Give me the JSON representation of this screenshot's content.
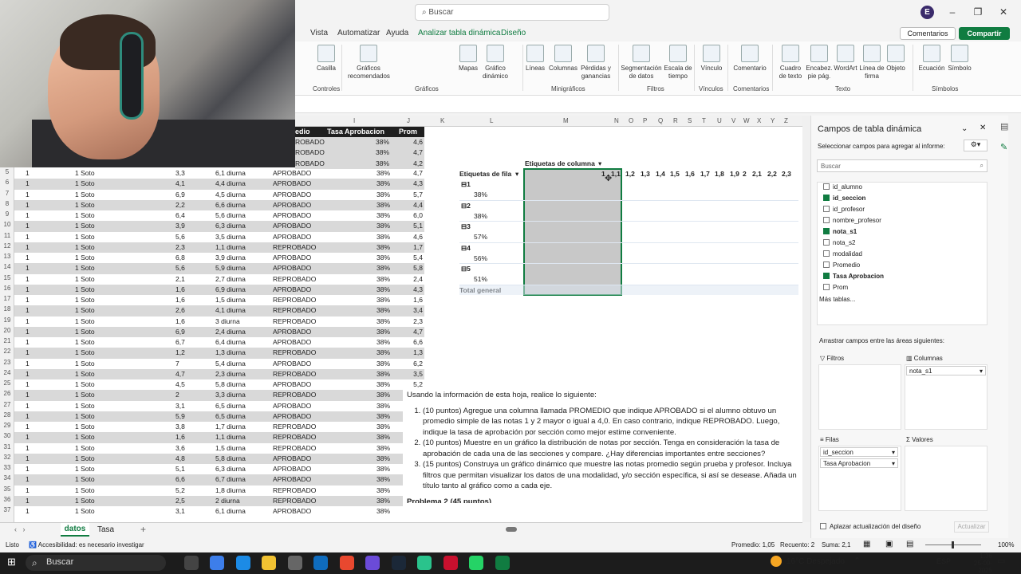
{
  "app": {
    "search_placeholder": "Buscar",
    "user_initial": "E"
  },
  "tabs": [
    "Vista",
    "Automatizar",
    "Ayuda",
    "Analizar tabla dinámica",
    "Diseño"
  ],
  "header_buttons": {
    "comments": "Comentarios",
    "share": "Compartir"
  },
  "ribbon": {
    "buttons": [
      {
        "label": "Casilla"
      },
      {
        "label": "Gráficos\nrecomendados"
      },
      {
        "label": "Mapas"
      },
      {
        "label": "Gráfico\ndinámico"
      },
      {
        "label": "Líneas"
      },
      {
        "label": "Columnas"
      },
      {
        "label": "Pérdidas y\nganancias"
      },
      {
        "label": "Segmentación\nde datos"
      },
      {
        "label": "Escala de\ntiempo"
      },
      {
        "label": "Vínculo"
      },
      {
        "label": "Comentario"
      },
      {
        "label": "Cuadro\nde texto"
      },
      {
        "label": "Encabez.\npie pág."
      },
      {
        "label": "WordArt"
      },
      {
        "label": "Línea de\nfirma"
      },
      {
        "label": "Objeto"
      },
      {
        "label": "Ecuación"
      },
      {
        "label": "Símbolo"
      }
    ],
    "groups": [
      "Controles",
      "Gráficos",
      "Minigráficos",
      "Filtros",
      "Vínculos",
      "Comentarios",
      "Texto",
      "Símbolos"
    ]
  },
  "col_headers": [
    "I",
    "J",
    "K",
    "L",
    "M",
    "N",
    "O",
    "P",
    "Q",
    "R",
    "S",
    "T",
    "U",
    "V",
    "W",
    "X",
    "Y",
    "Z"
  ],
  "data_header": {
    "c1": "edio",
    "c2": "Tasa Aprobacion",
    "c3": "Prom"
  },
  "top_rows": [
    {
      "h": "ROBADO",
      "t": "38%",
      "p": "4,6"
    },
    {
      "h": "ROBADO",
      "t": "38%",
      "p": "4,7"
    },
    {
      "h": "ROBADO",
      "t": "38%",
      "p": "4,2"
    }
  ],
  "rows": [
    {
      "n": "5",
      "a": "1",
      "b": "1 Soto",
      "c": "3,3",
      "d": "6,1 diurna",
      "e": "APROBADO",
      "f": "38%",
      "g": "4,7"
    },
    {
      "n": "6",
      "a": "1",
      "b": "1 Soto",
      "c": "4,1",
      "d": "4,4 diurna",
      "e": "APROBADO",
      "f": "38%",
      "g": "4,3"
    },
    {
      "n": "7",
      "a": "1",
      "b": "1 Soto",
      "c": "6,9",
      "d": "4,5 diurna",
      "e": "APROBADO",
      "f": "38%",
      "g": "5,7"
    },
    {
      "n": "8",
      "a": "1",
      "b": "1 Soto",
      "c": "2,2",
      "d": "6,6 diurna",
      "e": "APROBADO",
      "f": "38%",
      "g": "4,4"
    },
    {
      "n": "9",
      "a": "1",
      "b": "1 Soto",
      "c": "6,4",
      "d": "5,6 diurna",
      "e": "APROBADO",
      "f": "38%",
      "g": "6,0"
    },
    {
      "n": "10",
      "a": "1",
      "b": "1 Soto",
      "c": "3,9",
      "d": "6,3 diurna",
      "e": "APROBADO",
      "f": "38%",
      "g": "5,1"
    },
    {
      "n": "11",
      "a": "1",
      "b": "1 Soto",
      "c": "5,6",
      "d": "3,5 diurna",
      "e": "APROBADO",
      "f": "38%",
      "g": "4,6"
    },
    {
      "n": "12",
      "a": "1",
      "b": "1 Soto",
      "c": "2,3",
      "d": "1,1 diurna",
      "e": "REPROBADO",
      "f": "38%",
      "g": "1,7"
    },
    {
      "n": "13",
      "a": "1",
      "b": "1 Soto",
      "c": "6,8",
      "d": "3,9 diurna",
      "e": "APROBADO",
      "f": "38%",
      "g": "5,4"
    },
    {
      "n": "14",
      "a": "1",
      "b": "1 Soto",
      "c": "5,6",
      "d": "5,9 diurna",
      "e": "APROBADO",
      "f": "38%",
      "g": "5,8"
    },
    {
      "n": "15",
      "a": "1",
      "b": "1 Soto",
      "c": "2,1",
      "d": "2,7 diurna",
      "e": "REPROBADO",
      "f": "38%",
      "g": "2,4"
    },
    {
      "n": "16",
      "a": "1",
      "b": "1 Soto",
      "c": "1,6",
      "d": "6,9 diurna",
      "e": "APROBADO",
      "f": "38%",
      "g": "4,3"
    },
    {
      "n": "17",
      "a": "1",
      "b": "1 Soto",
      "c": "1,6",
      "d": "1,5 diurna",
      "e": "REPROBADO",
      "f": "38%",
      "g": "1,6"
    },
    {
      "n": "18",
      "a": "1",
      "b": "1 Soto",
      "c": "2,6",
      "d": "4,1 diurna",
      "e": "REPROBADO",
      "f": "38%",
      "g": "3,4"
    },
    {
      "n": "19",
      "a": "1",
      "b": "1 Soto",
      "c": "1,6",
      "d": "3 diurna",
      "e": "REPROBADO",
      "f": "38%",
      "g": "2,3"
    },
    {
      "n": "20",
      "a": "1",
      "b": "1 Soto",
      "c": "6,9",
      "d": "2,4 diurna",
      "e": "APROBADO",
      "f": "38%",
      "g": "4,7"
    },
    {
      "n": "21",
      "a": "1",
      "b": "1 Soto",
      "c": "6,7",
      "d": "6,4 diurna",
      "e": "APROBADO",
      "f": "38%",
      "g": "6,6"
    },
    {
      "n": "22",
      "a": "1",
      "b": "1 Soto",
      "c": "1,2",
      "d": "1,3 diurna",
      "e": "REPROBADO",
      "f": "38%",
      "g": "1,3"
    },
    {
      "n": "23",
      "a": "1",
      "b": "1 Soto",
      "c": "7",
      "d": "5,4 diurna",
      "e": "APROBADO",
      "f": "38%",
      "g": "6,2"
    },
    {
      "n": "24",
      "a": "1",
      "b": "1 Soto",
      "c": "4,7",
      "d": "2,3 diurna",
      "e": "REPROBADO",
      "f": "38%",
      "g": "3,5"
    },
    {
      "n": "25",
      "a": "1",
      "b": "1 Soto",
      "c": "4,5",
      "d": "5,8 diurna",
      "e": "APROBADO",
      "f": "38%",
      "g": "5,2"
    },
    {
      "n": "26",
      "a": "1",
      "b": "1 Soto",
      "c": "2",
      "d": "3,3 diurna",
      "e": "REPROBADO",
      "f": "38%",
      "g": ""
    },
    {
      "n": "27",
      "a": "1",
      "b": "1 Soto",
      "c": "3,1",
      "d": "6,5 diurna",
      "e": "APROBADO",
      "f": "38%",
      "g": ""
    },
    {
      "n": "28",
      "a": "1",
      "b": "1 Soto",
      "c": "5,9",
      "d": "6,5 diurna",
      "e": "APROBADO",
      "f": "38%",
      "g": ""
    },
    {
      "n": "29",
      "a": "1",
      "b": "1 Soto",
      "c": "3,8",
      "d": "1,7 diurna",
      "e": "REPROBADO",
      "f": "38%",
      "g": ""
    },
    {
      "n": "30",
      "a": "1",
      "b": "1 Soto",
      "c": "1,6",
      "d": "1,1 diurna",
      "e": "REPROBADO",
      "f": "38%",
      "g": ""
    },
    {
      "n": "31",
      "a": "1",
      "b": "1 Soto",
      "c": "3,6",
      "d": "1,5 diurna",
      "e": "REPROBADO",
      "f": "38%",
      "g": ""
    },
    {
      "n": "32",
      "a": "1",
      "b": "1 Soto",
      "c": "4,8",
      "d": "5,8 diurna",
      "e": "APROBADO",
      "f": "38%",
      "g": ""
    },
    {
      "n": "33",
      "a": "1",
      "b": "1 Soto",
      "c": "5,1",
      "d": "6,3 diurna",
      "e": "APROBADO",
      "f": "38%",
      "g": ""
    },
    {
      "n": "34",
      "a": "1",
      "b": "1 Soto",
      "c": "6,6",
      "d": "6,7 diurna",
      "e": "APROBADO",
      "f": "38%",
      "g": ""
    },
    {
      "n": "35",
      "a": "1",
      "b": "1 Soto",
      "c": "5,2",
      "d": "1,8 diurna",
      "e": "REPROBADO",
      "f": "38%",
      "g": ""
    },
    {
      "n": "36",
      "a": "1",
      "b": "1 Soto",
      "c": "2,5",
      "d": "2 diurna",
      "e": "REPROBADO",
      "f": "38%",
      "g": ""
    },
    {
      "n": "37",
      "a": "1",
      "b": "1 Soto",
      "c": "3,1",
      "d": "6,1 diurna",
      "e": "APROBADO",
      "f": "38%",
      "g": ""
    }
  ],
  "pivot": {
    "col_label": "Etiquetas de columna",
    "row_label": "Etiquetas de fila",
    "col_values": [
      "1",
      "1,1",
      "1,2",
      "1,3",
      "1,4",
      "1,5",
      "1,6",
      "1,7",
      "1,8",
      "1,9",
      "2",
      "2,1",
      "2,2",
      "2,3"
    ],
    "groups": [
      {
        "k": "1",
        "v": "38%"
      },
      {
        "k": "2",
        "v": "38%"
      },
      {
        "k": "3",
        "v": "57%"
      },
      {
        "k": "4",
        "v": "56%"
      },
      {
        "k": "5",
        "v": "51%"
      }
    ],
    "total": "Total general"
  },
  "problem": {
    "intro": "Usando la información de esta hoja, realice lo siguiente:",
    "items": [
      "(10 puntos) Agregue una columna llamada PROMEDIO que indique APROBADO si el alumno obtuvo un promedio simple de las notas 1 y 2 mayor o igual a 4,0. En caso contrario, indique REPROBADO. Luego, indique la tasa de aprobación por sección como mejor estime conveniente.",
      "(10 puntos) Muestre en un gráfico la distribución de notas por sección. Tenga en consideración la tasa de aprobación de cada una de las secciones y compare. ¿Hay diferencias importantes entre secciones?",
      "(15 puntos) Construya un gráfico dinámico que muestre las notas promedio según prueba y profesor. Incluya filtros que permitan visualizar los datos de una modalidad, y/o sección específica, si así se desease. Añada un título tanto al gráfico como a cada eje."
    ],
    "next": "Problema 2 (45 puntos)"
  },
  "sheet_tabs": [
    "datos",
    "Tasa"
  ],
  "pane": {
    "title": "Campos de tabla dinámica",
    "subtitle": "Seleccionar campos para agregar al informe:",
    "search": "Buscar",
    "fields": [
      {
        "name": "id_alumno",
        "on": false
      },
      {
        "name": "id_seccion",
        "on": true
      },
      {
        "name": "id_profesor",
        "on": false
      },
      {
        "name": "nombre_profesor",
        "on": false
      },
      {
        "name": "nota_s1",
        "on": true
      },
      {
        "name": "nota_s2",
        "on": false
      },
      {
        "name": "modalidad",
        "on": false
      },
      {
        "name": "Promedio",
        "on": false
      },
      {
        "name": "Tasa Aprobacion",
        "on": true
      },
      {
        "name": "Prom",
        "on": false
      }
    ],
    "more": "Más tablas...",
    "drag_label": "Arrastrar campos entre las áreas siguientes:",
    "filters": "Filtros",
    "columns": "Columnas",
    "rows": "Filas",
    "values": "Valores",
    "col_chip": "nota_s1",
    "row_chips": [
      "id_seccion",
      "Tasa Aprobacion"
    ],
    "defer": "Aplazar actualización del diseño",
    "update": "Actualizar"
  },
  "status": {
    "ready": "Listo",
    "accessibility": "Accesibilidad: es necesario investigar",
    "avg": "Promedio: 1,05",
    "count": "Recuento: 2",
    "sum": "Suma: 2,1",
    "zoom": "100%"
  },
  "taskbar": {
    "search": "Buscar",
    "weather": "16°C  Despejado",
    "lang": "ESP",
    "time": "1:36",
    "date": "25-09-2025"
  }
}
